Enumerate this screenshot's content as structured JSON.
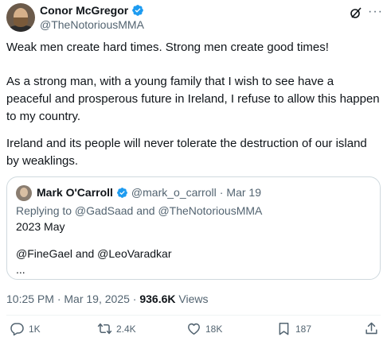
{
  "author": {
    "display_name": "Conor McGregor",
    "handle": "@TheNotoriousMMA"
  },
  "tweet": {
    "paragraphs": [
      "Weak men create hard times. Strong men create good times!",
      "As a strong man, with a young family that I wish to see have a peaceful and prosperous future in Ireland, I refuse to allow this happen to my country.",
      "Ireland and its people will never tolerate the destruction of our island by weaklings."
    ]
  },
  "quote": {
    "display_name": "Mark O'Carroll",
    "handle": "@mark_o_carroll",
    "separator": "·",
    "date": "Mar 19",
    "replying_to": "Replying to @GadSaad and @TheNotoriousMMA",
    "lines": [
      "2023 May",
      "@FineGael and @LeoVaradkar",
      "..."
    ]
  },
  "meta": {
    "time": "10:25 PM",
    "separator": "·",
    "date": "Mar 19, 2025",
    "views_count": "936.6K",
    "views_label": "Views"
  },
  "actions": {
    "replies": "1K",
    "reposts": "2.4K",
    "likes": "18K",
    "bookmarks": "187"
  },
  "icons": {
    "verified": "verified-badge-icon",
    "grok": "grok-icon",
    "more": "more-icon",
    "reply": "reply-icon",
    "repost": "repost-icon",
    "like": "heart-icon",
    "bookmark": "bookmark-icon",
    "share": "share-icon"
  },
  "colors": {
    "verified": "#1d9bf0",
    "text": "#0f1419",
    "secondary": "#536471",
    "border": "#cfd9de"
  }
}
